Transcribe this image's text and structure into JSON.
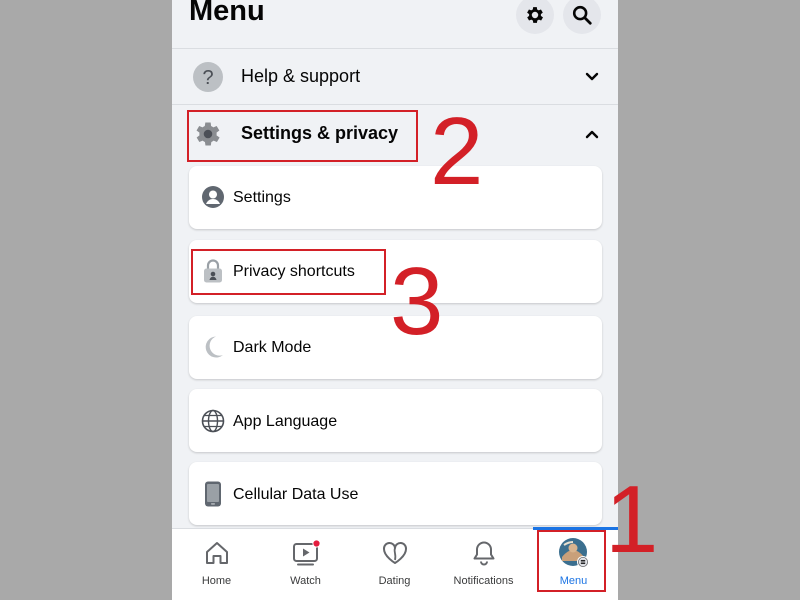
{
  "header": {
    "title": "Menu",
    "icons": [
      "gear-icon",
      "search-icon"
    ]
  },
  "sections": {
    "help": {
      "label": "Help & support",
      "icon": "help-icon",
      "expanded": false
    },
    "settings_privacy": {
      "label": "Settings & privacy",
      "icon": "gear-icon",
      "expanded": true
    }
  },
  "items": [
    {
      "label": "Settings",
      "icon": "profile-settings-icon"
    },
    {
      "label": "Privacy shortcuts",
      "icon": "lock-icon"
    },
    {
      "label": "Dark Mode",
      "icon": "moon-icon"
    },
    {
      "label": "App Language",
      "icon": "globe-icon"
    },
    {
      "label": "Cellular Data Use",
      "icon": "phone-icon"
    }
  ],
  "tabs": [
    {
      "label": "Home",
      "icon": "home-icon"
    },
    {
      "label": "Watch",
      "icon": "watch-icon"
    },
    {
      "label": "Dating",
      "icon": "dating-icon"
    },
    {
      "label": "Notifications",
      "icon": "bell-icon"
    },
    {
      "label": "Menu",
      "icon": "avatar-menu-icon",
      "active": true
    }
  ],
  "annotations": {
    "step1": "1",
    "step2": "2",
    "step3": "3"
  },
  "colors": {
    "annotation_red": "#d32027",
    "active_blue": "#1b74e4",
    "background": "#f0f2f5"
  }
}
